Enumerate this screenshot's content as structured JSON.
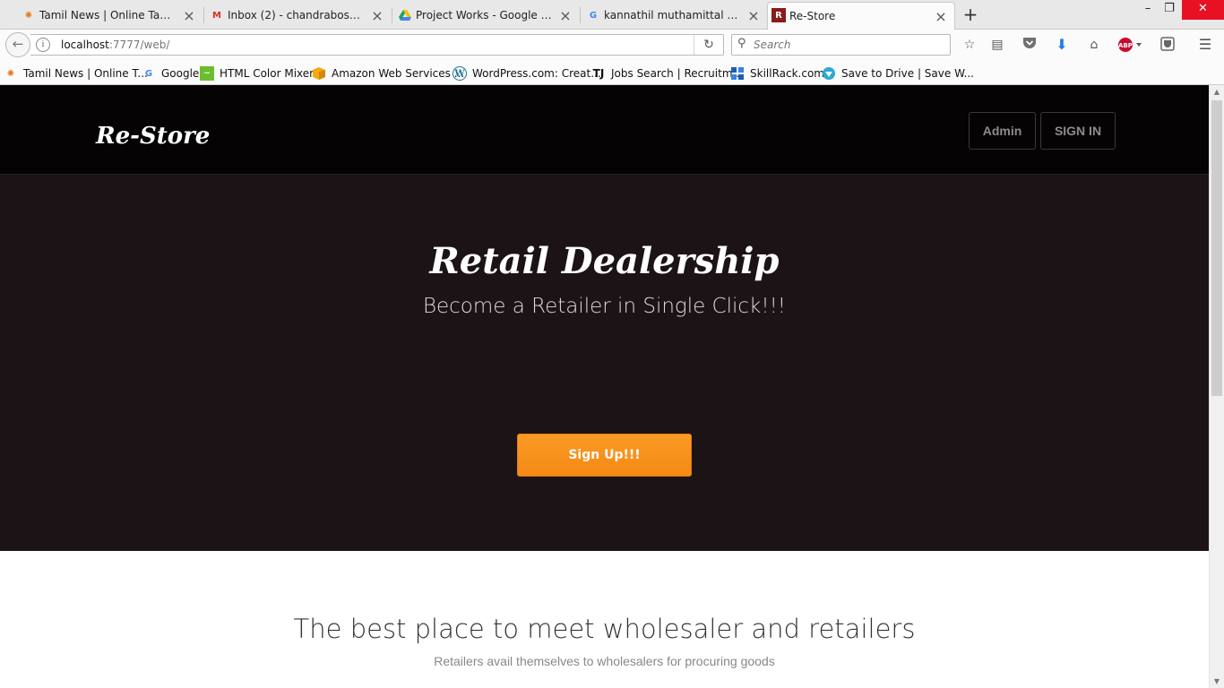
{
  "browser": {
    "tabs": [
      {
        "label": "Tamil News | Online Tamil...",
        "icon": "tamilnews-favicon",
        "active": false
      },
      {
        "label": "Inbox (2) - chandrabose71...",
        "icon": "gmail-favicon",
        "active": false
      },
      {
        "label": "Project Works - Google Dr...",
        "icon": "google-drive-favicon",
        "active": false
      },
      {
        "label": "kannathil muthamittal no...",
        "icon": "google-favicon",
        "active": false
      },
      {
        "label": "Re-Store",
        "icon": "restore-favicon",
        "active": true
      }
    ],
    "url_host": "localhost",
    "url_rest": ":7777/web/",
    "search_placeholder": "Search",
    "bookmarks": [
      {
        "label": "Tamil News | Online T...",
        "icon": "tamilnews-favicon"
      },
      {
        "label": "Google",
        "icon": "google-favicon"
      },
      {
        "label": "HTML Color Mixer",
        "icon": "color-mixer-favicon"
      },
      {
        "label": "Amazon Web Services ...",
        "icon": "aws-favicon"
      },
      {
        "label": "WordPress.com: Creat...",
        "icon": "wordpress-favicon"
      },
      {
        "label": "Jobs Search | Recruitm...",
        "icon": "timesjobs-favicon"
      },
      {
        "label": "SkillRack.com",
        "icon": "skillrack-favicon"
      },
      {
        "label": "Save to Drive | Save W...",
        "icon": "save-to-drive-favicon"
      }
    ]
  },
  "site": {
    "brand": "Re-Store",
    "nav": {
      "admin_label": "Admin",
      "signin_label": "SIGN IN"
    },
    "hero": {
      "title": "Retail Dealership",
      "subtitle": "Become a Retailer in Single Click!!!",
      "cta_label": "Sign Up!!!"
    },
    "section": {
      "title": "The best place to meet wholesaler and retailers",
      "subtitle": "Retailers avail themselves to wholesalers for procuring goods"
    }
  },
  "colors": {
    "header_bg": "#060304",
    "hero_bg": "#1c1316",
    "cta_bg": "#f7911d"
  }
}
